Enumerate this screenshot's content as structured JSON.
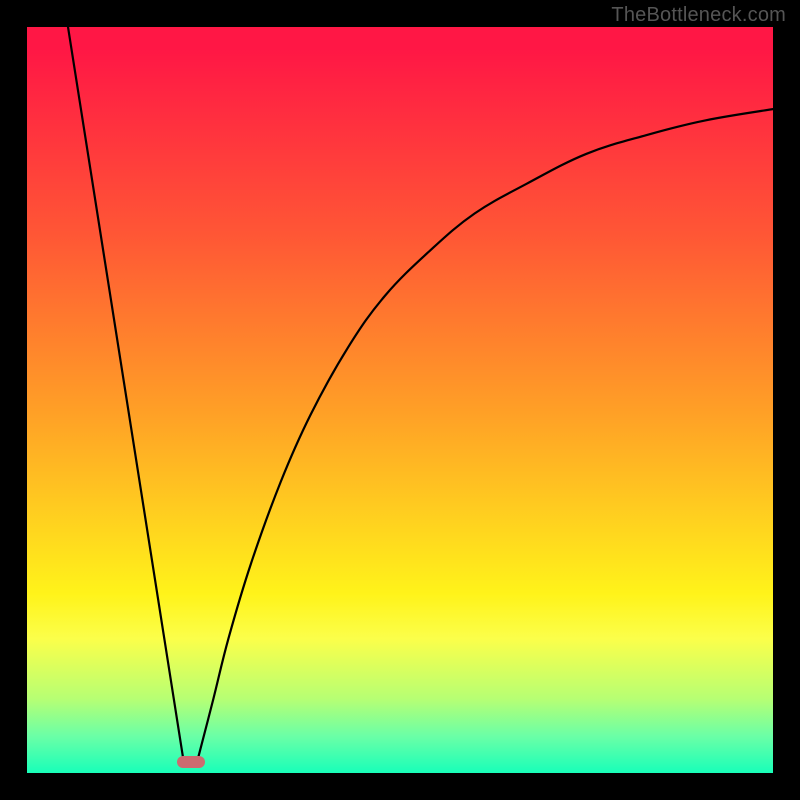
{
  "watermark": "TheBottleneck.com",
  "gradient": {
    "stops": [
      {
        "pct": 0,
        "color": "#ff1745"
      },
      {
        "pct": 3,
        "color": "#ff1745"
      },
      {
        "pct": 28,
        "color": "#ff5735"
      },
      {
        "pct": 52,
        "color": "#ffa126"
      },
      {
        "pct": 76,
        "color": "#fff31a"
      },
      {
        "pct": 82,
        "color": "#fbff4a"
      },
      {
        "pct": 90,
        "color": "#b7ff73"
      },
      {
        "pct": 95,
        "color": "#6cffa6"
      },
      {
        "pct": 100,
        "color": "#18ffb9"
      }
    ]
  },
  "chart_data": {
    "type": "line",
    "title": "",
    "xlabel": "",
    "ylabel": "",
    "xlim": [
      0,
      100
    ],
    "ylim": [
      0,
      100
    ],
    "series": [
      {
        "name": "left-branch",
        "x": [
          5.5,
          21.0
        ],
        "values": [
          100,
          1.5
        ]
      },
      {
        "name": "right-branch",
        "x": [
          22.8,
          25,
          27,
          30,
          34,
          38,
          43,
          48,
          54,
          60,
          67,
          75,
          83,
          91,
          100
        ],
        "values": [
          1.5,
          10,
          18,
          28,
          39,
          48,
          57,
          64,
          70,
          75,
          79,
          83,
          85.5,
          87.5,
          89
        ]
      }
    ],
    "marker": {
      "x": 22.0,
      "y": 1.5,
      "color": "#cc6b70",
      "shape": "rounded-rect"
    },
    "annotations": [
      {
        "text": "TheBottleneck.com",
        "role": "watermark",
        "position": "top-right"
      }
    ]
  }
}
